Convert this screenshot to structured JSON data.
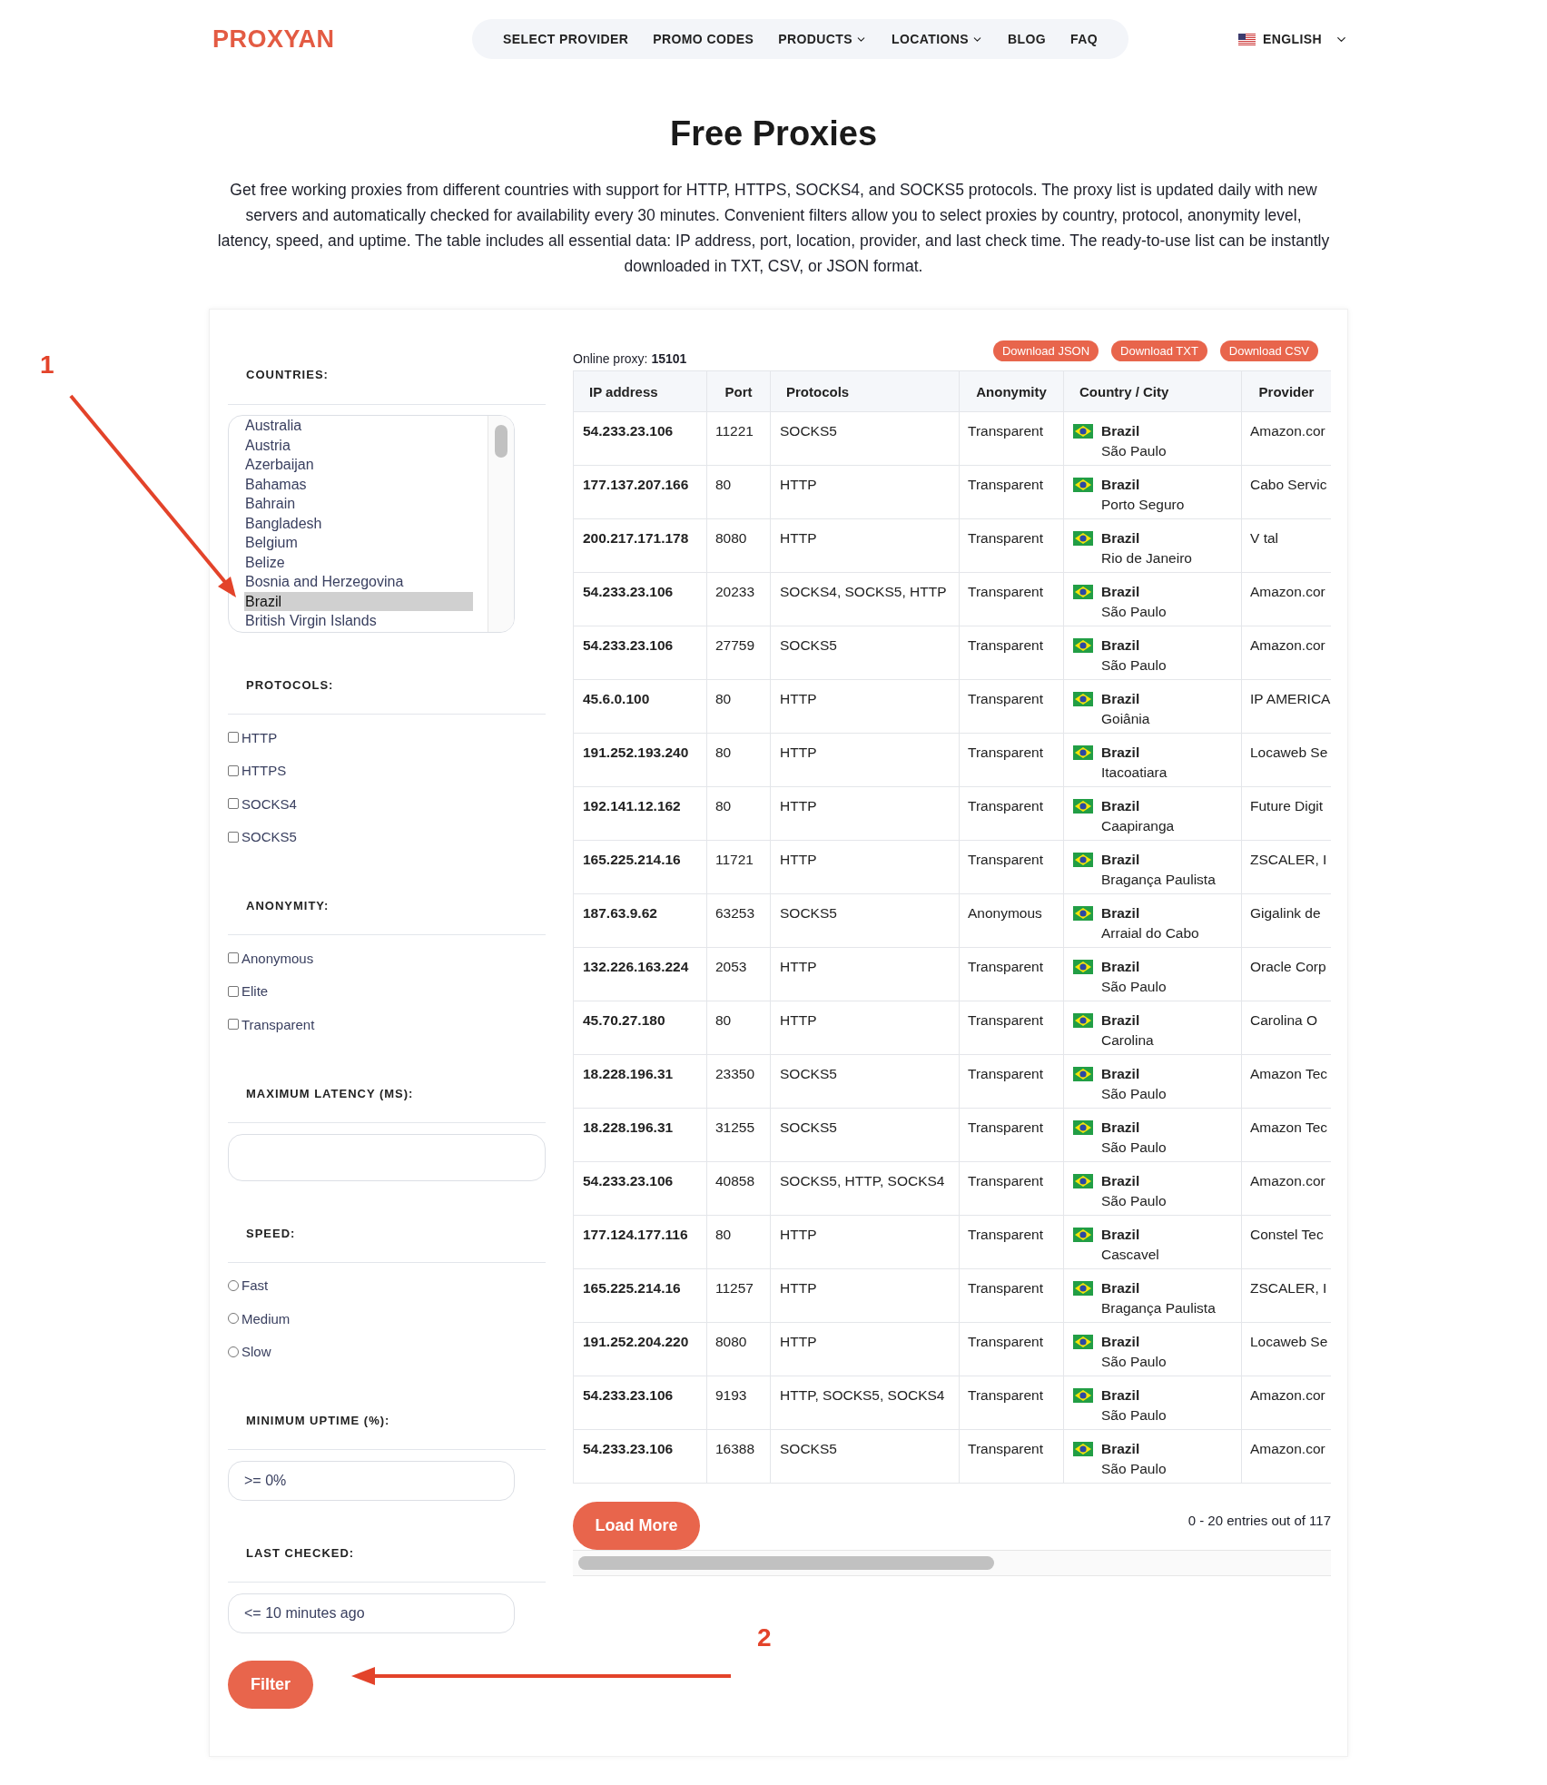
{
  "header": {
    "logo": "PROXYAN",
    "nav": [
      {
        "label": "SELECT PROVIDER",
        "dropdown": false
      },
      {
        "label": "PROMO CODES",
        "dropdown": false
      },
      {
        "label": "PRODUCTS",
        "dropdown": true
      },
      {
        "label": "LOCATIONS",
        "dropdown": true
      },
      {
        "label": "BLOG",
        "dropdown": false
      },
      {
        "label": "FAQ",
        "dropdown": false
      }
    ],
    "language": "ENGLISH"
  },
  "page": {
    "title": "Free Proxies",
    "intro": "Get free working proxies from different countries with support for HTTP, HTTPS, SOCKS4, and SOCKS5 protocols. The proxy list is updated daily with new servers and automatically checked for availability every 30 minutes. Convenient filters allow you to select proxies by country, protocol, anonymity level, latency, speed, and uptime. The table includes all essential data: IP address, port, location, provider, and last check time. The ready-to-use list can be instantly downloaded in TXT, CSV, or JSON format."
  },
  "filters": {
    "countries": {
      "label": "COUNTRIES:",
      "items": [
        {
          "name": "Australia",
          "selected": false
        },
        {
          "name": "Austria",
          "selected": false
        },
        {
          "name": "Azerbaijan",
          "selected": false
        },
        {
          "name": "Bahamas",
          "selected": false
        },
        {
          "name": "Bahrain",
          "selected": false
        },
        {
          "name": "Bangladesh",
          "selected": false
        },
        {
          "name": "Belgium",
          "selected": false
        },
        {
          "name": "Belize",
          "selected": false
        },
        {
          "name": "Bosnia and Herzegovina",
          "selected": false
        },
        {
          "name": "Brazil",
          "selected": true
        },
        {
          "name": "British Virgin Islands",
          "selected": false
        }
      ]
    },
    "protocols": {
      "label": "PROTOCOLS:",
      "options": [
        {
          "label": "HTTP",
          "checked": false
        },
        {
          "label": "HTTPS",
          "checked": false
        },
        {
          "label": "SOCKS4",
          "checked": false
        },
        {
          "label": "SOCKS5",
          "checked": false
        }
      ]
    },
    "anonymity": {
      "label": "ANONYMITY:",
      "options": [
        {
          "label": "Anonymous",
          "checked": false
        },
        {
          "label": "Elite",
          "checked": false
        },
        {
          "label": "Transparent",
          "checked": false
        }
      ]
    },
    "latency": {
      "label": "MAXIMUM LATENCY (MS):"
    },
    "speed": {
      "label": "SPEED:",
      "options": [
        {
          "label": "Fast",
          "selected": false
        },
        {
          "label": "Medium",
          "selected": false
        },
        {
          "label": "Slow",
          "selected": false
        }
      ]
    },
    "uptime": {
      "label": "MINIMUM UPTIME (%):",
      "value": ">= 0%"
    },
    "last_checked": {
      "label": "LAST CHECKED:",
      "value": "<= 10 minutes ago"
    },
    "filter_button": "Filter"
  },
  "results": {
    "online": "Online proxy: **15101**",
    "downloads": [
      "Download JSON",
      "Download TXT",
      "Download CSV"
    ],
    "table": {
      "columns": [
        "IP address",
        "Port",
        "Protocols",
        "Anonymity",
        "Country / City",
        "Provider"
      ],
      "rows": [
        {
          "ip": "54.233.23.106",
          "port": "11221",
          "protocols": "SOCKS5",
          "anonymity": "Transparent",
          "country": "Brazil",
          "city": "São Paulo",
          "provider": "Amazon.cor"
        },
        {
          "ip": "177.137.207.166",
          "port": "80",
          "protocols": "HTTP",
          "anonymity": "Transparent",
          "country": "Brazil",
          "city": "Porto Seguro",
          "provider": "Cabo Servic"
        },
        {
          "ip": "200.217.171.178",
          "port": "8080",
          "protocols": "HTTP",
          "anonymity": "Transparent",
          "country": "Brazil",
          "city": "Rio de Janeiro",
          "provider": "V tal"
        },
        {
          "ip": "54.233.23.106",
          "port": "20233",
          "protocols": "SOCKS4, SOCKS5, HTTP",
          "anonymity": "Transparent",
          "country": "Brazil",
          "city": "São Paulo",
          "provider": "Amazon.cor"
        },
        {
          "ip": "54.233.23.106",
          "port": "27759",
          "protocols": "SOCKS5",
          "anonymity": "Transparent",
          "country": "Brazil",
          "city": "São Paulo",
          "provider": "Amazon.cor"
        },
        {
          "ip": "45.6.0.100",
          "port": "80",
          "protocols": "HTTP",
          "anonymity": "Transparent",
          "country": "Brazil",
          "city": "Goiânia",
          "provider": "IP AMERICA"
        },
        {
          "ip": "191.252.193.240",
          "port": "80",
          "protocols": "HTTP",
          "anonymity": "Transparent",
          "country": "Brazil",
          "city": "Itacoatiara",
          "provider": "Locaweb Se"
        },
        {
          "ip": "192.141.12.162",
          "port": "80",
          "protocols": "HTTP",
          "anonymity": "Transparent",
          "country": "Brazil",
          "city": "Caapiranga",
          "provider": "Future Digit"
        },
        {
          "ip": "165.225.214.16",
          "port": "11721",
          "protocols": "HTTP",
          "anonymity": "Transparent",
          "country": "Brazil",
          "city": "Bragança Paulista",
          "provider": "ZSCALER, I"
        },
        {
          "ip": "187.63.9.62",
          "port": "63253",
          "protocols": "SOCKS5",
          "anonymity": "Anonymous",
          "country": "Brazil",
          "city": "Arraial do Cabo",
          "provider": "Gigalink de"
        },
        {
          "ip": "132.226.163.224",
          "port": "2053",
          "protocols": "HTTP",
          "anonymity": "Transparent",
          "country": "Brazil",
          "city": "São Paulo",
          "provider": "Oracle Corp"
        },
        {
          "ip": "45.70.27.180",
          "port": "80",
          "protocols": "HTTP",
          "anonymity": "Transparent",
          "country": "Brazil",
          "city": "Carolina",
          "provider": "Carolina O"
        },
        {
          "ip": "18.228.196.31",
          "port": "23350",
          "protocols": "SOCKS5",
          "anonymity": "Transparent",
          "country": "Brazil",
          "city": "São Paulo",
          "provider": "Amazon Tec"
        },
        {
          "ip": "18.228.196.31",
          "port": "31255",
          "protocols": "SOCKS5",
          "anonymity": "Transparent",
          "country": "Brazil",
          "city": "São Paulo",
          "provider": "Amazon Tec"
        },
        {
          "ip": "54.233.23.106",
          "port": "40858",
          "protocols": "SOCKS5, HTTP, SOCKS4",
          "anonymity": "Transparent",
          "country": "Brazil",
          "city": "São Paulo",
          "provider": "Amazon.cor"
        },
        {
          "ip": "177.124.177.116",
          "port": "80",
          "protocols": "HTTP",
          "anonymity": "Transparent",
          "country": "Brazil",
          "city": "Cascavel",
          "provider": "Constel Tec"
        },
        {
          "ip": "165.225.214.16",
          "port": "11257",
          "protocols": "HTTP",
          "anonymity": "Transparent",
          "country": "Brazil",
          "city": "Bragança Paulista",
          "provider": "ZSCALER, I"
        },
        {
          "ip": "191.252.204.220",
          "port": "8080",
          "protocols": "HTTP",
          "anonymity": "Transparent",
          "country": "Brazil",
          "city": "São Paulo",
          "provider": "Locaweb Se"
        },
        {
          "ip": "54.233.23.106",
          "port": "9193",
          "protocols": "HTTP, SOCKS5, SOCKS4",
          "anonymity": "Transparent",
          "country": "Brazil",
          "city": "São Paulo",
          "provider": "Amazon.cor"
        },
        {
          "ip": "54.233.23.106",
          "port": "16388",
          "protocols": "SOCKS5",
          "anonymity": "Transparent",
          "country": "Brazil",
          "city": "São Paulo",
          "provider": "Amazon.cor"
        }
      ]
    },
    "load_more": "Load More",
    "entries": "0 - 20 entries out of 117"
  },
  "annotations": [
    {
      "label": "1"
    },
    {
      "label": "2"
    }
  ]
}
